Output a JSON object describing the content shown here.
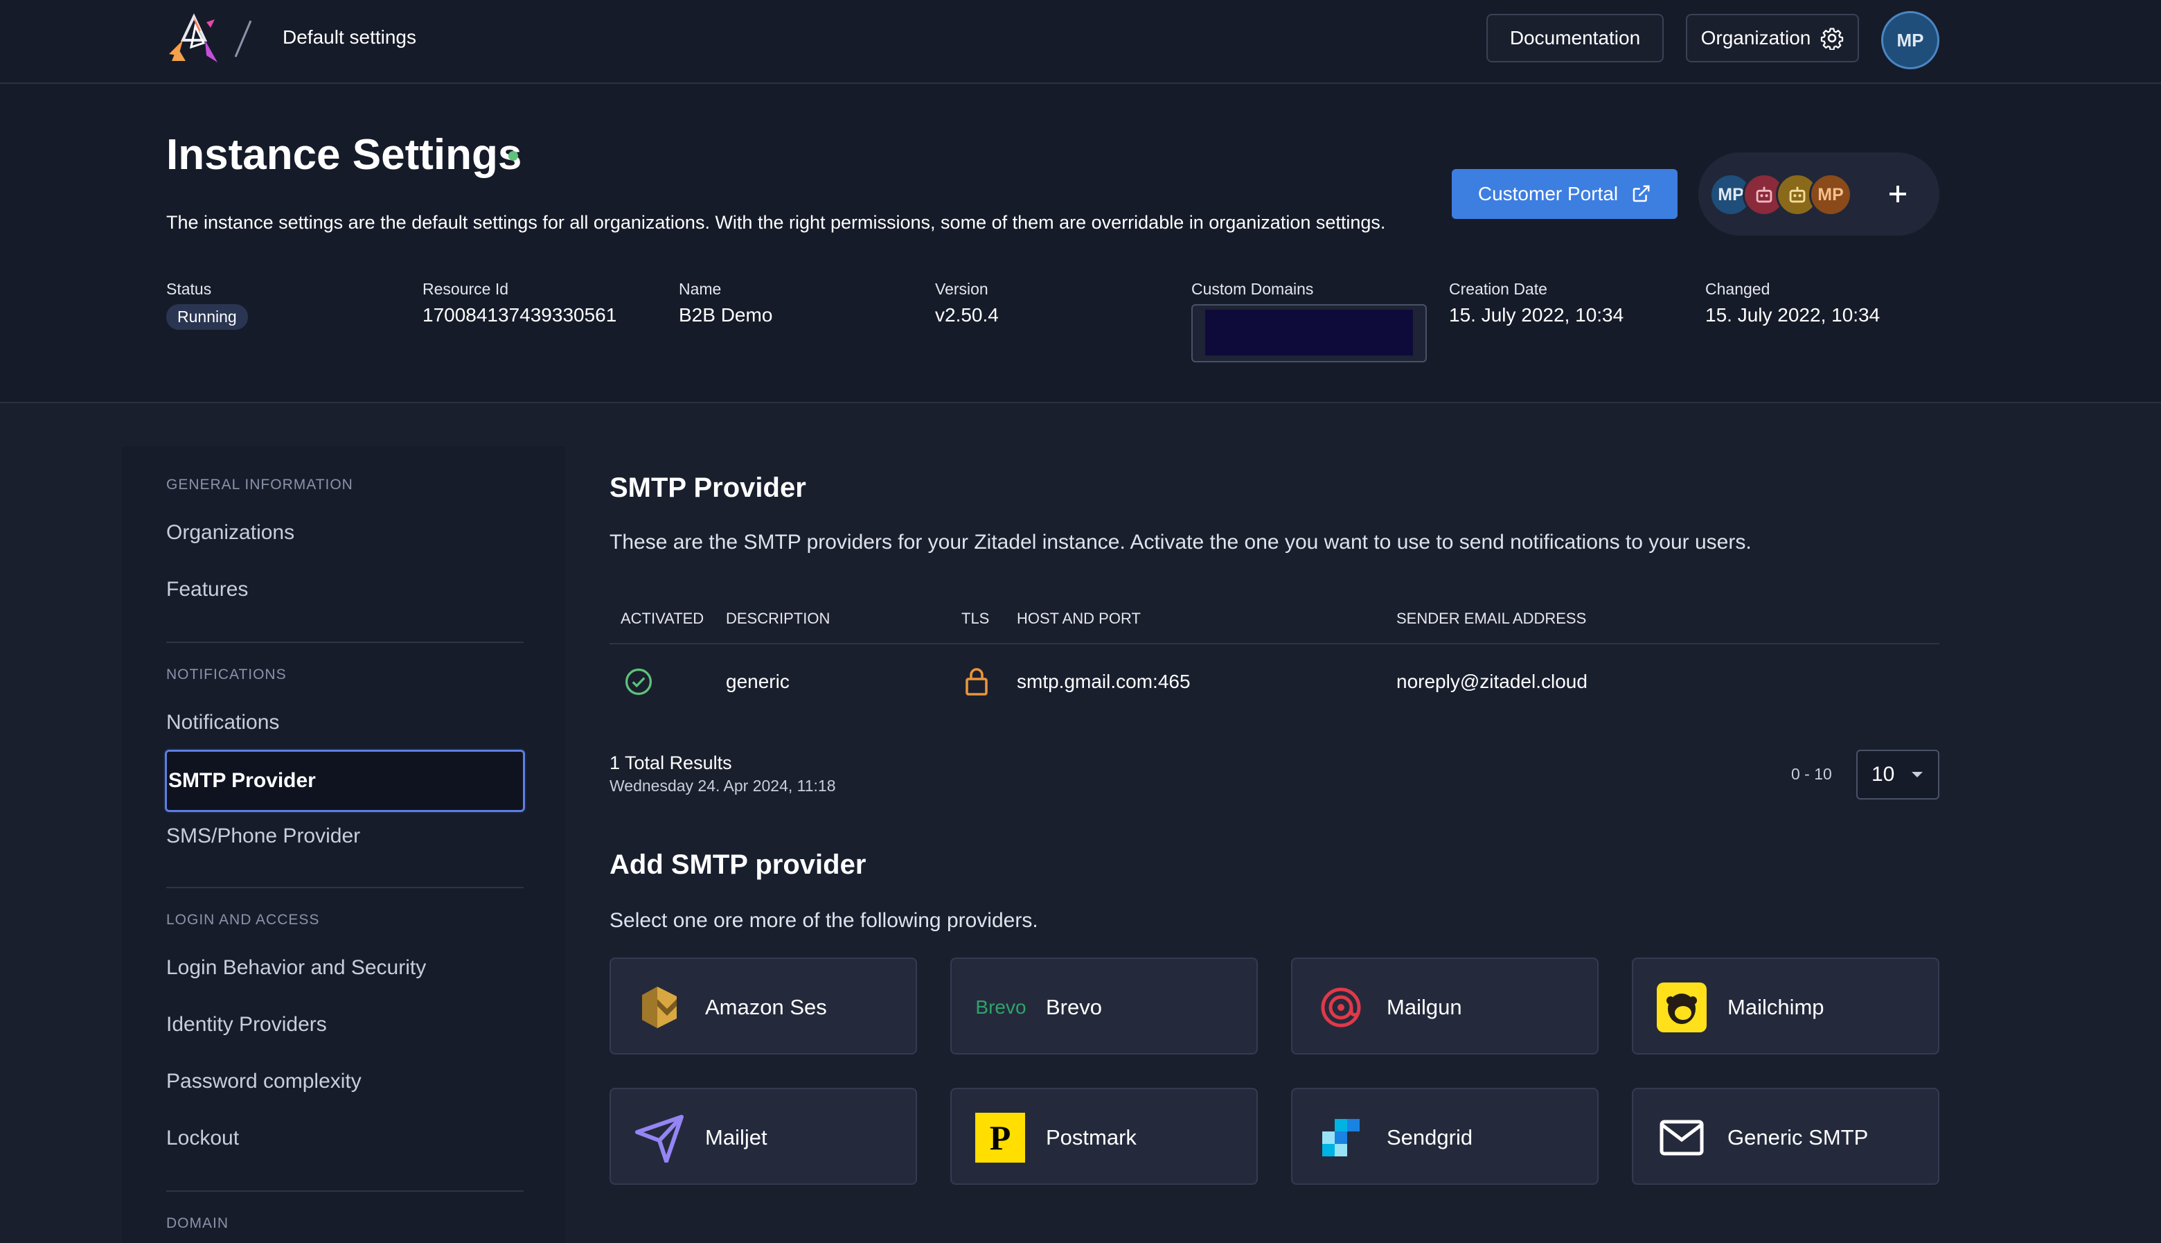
{
  "topbar": {
    "breadcrumb": "Default settings",
    "documentation_label": "Documentation",
    "organization_label": "Organization",
    "user_initials": "MP"
  },
  "header": {
    "title": "Instance Settings",
    "subtitle": "The instance settings are the default settings for all organizations. With the right permissions, some of them are overridable in organization settings.",
    "customer_portal_label": "Customer Portal",
    "members": [
      "MP",
      "robot",
      "robot",
      "MP"
    ],
    "info": {
      "status_label": "Status",
      "status_value": "Running",
      "resource_label": "Resource Id",
      "resource_value": "170084137439330561",
      "name_label": "Name",
      "name_value": "B2B Demo",
      "version_label": "Version",
      "version_value": "v2.50.4",
      "domains_label": "Custom Domains",
      "creation_label": "Creation Date",
      "creation_value": "15. July 2022, 10:34",
      "changed_label": "Changed",
      "changed_value": "15. July 2022, 10:34"
    }
  },
  "sidebar": {
    "general_heading": "GENERAL INFORMATION",
    "organizations": "Organizations",
    "features": "Features",
    "notifications_heading": "NOTIFICATIONS",
    "notifications": "Notifications",
    "smtp_provider": "SMTP Provider",
    "sms_provider": "SMS/Phone Provider",
    "login_heading": "LOGIN AND ACCESS",
    "login_behavior": "Login Behavior and Security",
    "identity_providers": "Identity Providers",
    "password_complexity": "Password complexity",
    "lockout": "Lockout",
    "domain_heading": "DOMAIN"
  },
  "main": {
    "title": "SMTP Provider",
    "description": "These are the SMTP providers for your Zitadel instance. Activate the one you want to use to send notifications to your users.",
    "table": {
      "headers": {
        "activated": "ACTIVATED",
        "description": "DESCRIPTION",
        "tls": "TLS",
        "host": "HOST AND PORT",
        "sender": "SENDER EMAIL ADDRESS"
      },
      "row": {
        "description": "generic",
        "host": "smtp.gmail.com:465",
        "sender": "noreply@zitadel.cloud"
      }
    },
    "results_count": "1 Total Results",
    "results_date": "Wednesday 24. Apr 2024, 11:18",
    "range_label": "0 - 10",
    "page_size": "10",
    "add_title": "Add SMTP provider",
    "add_description": "Select one ore more of the following providers.",
    "providers": {
      "amazon": "Amazon Ses",
      "brevo": "Brevo",
      "brevo_logo_text": "Brevo",
      "mailgun": "Mailgun",
      "mailchimp": "Mailchimp",
      "mailjet": "Mailjet",
      "postmark": "Postmark",
      "postmark_logo_text": "P",
      "sendgrid": "Sendgrid",
      "generic": "Generic SMTP"
    }
  },
  "colors": {
    "background": "#1a1f2e",
    "accent": "#3d7ee1",
    "status_green": "#5ec27a",
    "tls_orange": "#e9953b"
  }
}
